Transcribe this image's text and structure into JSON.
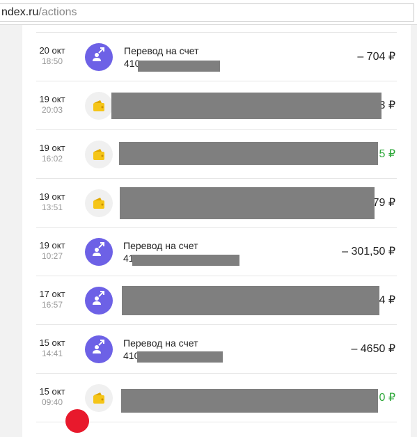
{
  "browser": {
    "url_host": "ndex.ru",
    "url_path": "/actions"
  },
  "currency": "₽",
  "transactions": [
    {
      "day": "20 окт",
      "time": "18:50",
      "icon": "transfer-icon",
      "title": "Перевод на счет",
      "account": "410",
      "amount": "– 704 ₽",
      "positive": false
    },
    {
      "day": "19 окт",
      "time": "20:03",
      "icon": "wallet-icon",
      "title": "",
      "account": "",
      "amount": "3 ₽",
      "positive": false
    },
    {
      "day": "19 окт",
      "time": "16:02",
      "icon": "wallet-icon",
      "title": "",
      "account": "",
      "amount": "5 ₽",
      "positive": true
    },
    {
      "day": "19 окт",
      "time": "13:51",
      "icon": "wallet-icon",
      "title": "",
      "account": "",
      "amount": "79 ₽",
      "positive": false
    },
    {
      "day": "19 окт",
      "time": "10:27",
      "icon": "transfer-icon",
      "title": "Перевод на счет",
      "account": "41",
      "amount": "– 301,50 ₽",
      "positive": false
    },
    {
      "day": "17 окт",
      "time": "16:57",
      "icon": "transfer-icon",
      "title": "",
      "account": "",
      "amount": "4 ₽",
      "positive": false
    },
    {
      "day": "15 окт",
      "time": "14:41",
      "icon": "transfer-icon",
      "title": "Перевод на счет",
      "account": "410",
      "amount": "– 4650 ₽",
      "positive": false
    },
    {
      "day": "15 окт",
      "time": "09:40",
      "icon": "wallet-icon",
      "title": "",
      "account": "",
      "amount": "0 ₽",
      "positive": true
    }
  ],
  "colors": {
    "transfer": "#6d61e6",
    "wallet": "#f5c518",
    "income": "#2ea83a",
    "redaction": "#7f7f7f"
  }
}
